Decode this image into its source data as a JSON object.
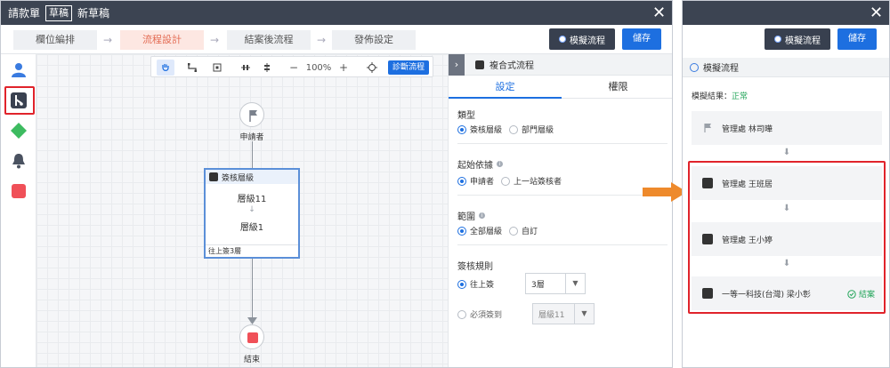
{
  "left_window": {
    "title": "請款單",
    "badge": "草稿",
    "draft_name": "新草稿",
    "steps": [
      "欄位編排",
      "流程設計",
      "結案後流程",
      "發佈設定"
    ],
    "active_step": 1,
    "simulate_label": "模擬流程",
    "save_label": "儲存",
    "toolbar": {
      "zoom": "100%",
      "minus": "−",
      "plus": "+",
      "diagnose_label": "診斷流程"
    },
    "canvas": {
      "start_label": "申請者",
      "approval_title": "簽核層級",
      "level_top": "層級11",
      "level_bottom": "層級1",
      "approval_footer": "往上簽3層",
      "end_label": "結束"
    },
    "panel": {
      "title": "複合式流程",
      "tabs": [
        "設定",
        "權限"
      ],
      "type_title": "類型",
      "type_options": [
        "簽核層級",
        "部門層級"
      ],
      "start_basis_title": "起始依據",
      "start_basis_options": [
        "申請者",
        "上一站簽核者"
      ],
      "scope_title": "範圍",
      "scope_options": [
        "全部層級",
        "自訂"
      ],
      "rule_title": "簽核規則",
      "rule_up_label": "往上簽",
      "rule_up_value": "3層",
      "rule_must_label": "必須簽到",
      "rule_must_value": "層級11"
    }
  },
  "right_window": {
    "simulate_label": "模擬流程",
    "save_label": "儲存",
    "header_title": "模擬流程",
    "result_label": "模擬結果：",
    "result_value": "正常",
    "nodes": [
      {
        "text": "管理處 林司曄"
      },
      {
        "text": "管理處 王班居"
      },
      {
        "text": "管理處 王小婷"
      },
      {
        "text": "一等一科技(台灣) 梁小彰",
        "status": "結案"
      }
    ]
  },
  "colors": {
    "titlebar": "#3c4452",
    "accent_blue": "#1d6fe0",
    "active_step": "#e36b53",
    "highlight_red": "#e0232b",
    "arrow_orange": "#ee8a2c",
    "success_green": "#23a55a"
  }
}
